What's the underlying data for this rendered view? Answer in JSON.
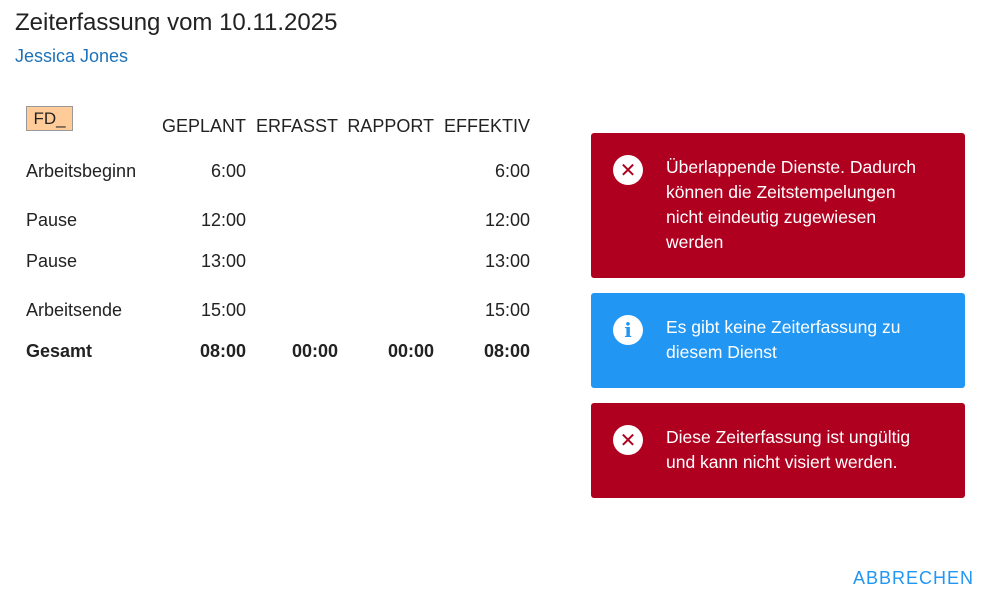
{
  "header": {
    "title": "Zeiterfassung vom 10.11.2025",
    "person": "Jessica Jones"
  },
  "shift": {
    "badge": "FD_",
    "badge_color": "#ffcc99"
  },
  "table": {
    "columns": [
      "GEPLANT",
      "ERFASST",
      "RAPPORT",
      "EFFEKTIV"
    ],
    "rows": [
      {
        "label": "Arbeitsbeginn",
        "geplant": "6:00",
        "erfasst": "",
        "rapport": "",
        "effektiv": "6:00"
      },
      {
        "label": "Pause",
        "geplant": "12:00",
        "erfasst": "",
        "rapport": "",
        "effektiv": "12:00"
      },
      {
        "label": "Pause",
        "geplant": "13:00",
        "erfasst": "",
        "rapport": "",
        "effektiv": "13:00"
      },
      {
        "label": "Arbeitsende",
        "geplant": "15:00",
        "erfasst": "",
        "rapport": "",
        "effektiv": "15:00"
      }
    ],
    "total": {
      "label": "Gesamt",
      "geplant": "08:00",
      "erfasst": "00:00",
      "rapport": "00:00",
      "effektiv": "08:00"
    }
  },
  "alerts": [
    {
      "type": "error",
      "icon": "close-circle-icon",
      "color": "#b00020",
      "lines": [
        "Überlappende Dienste. Dadurch",
        "können die Zeitstempelungen",
        "nicht eindeutig zugewiesen",
        "werden"
      ]
    },
    {
      "type": "info",
      "icon": "info-circle-icon",
      "color": "#2196f3",
      "lines": [
        "Es gibt keine Zeiterfassung zu",
        "diesem Dienst"
      ]
    },
    {
      "type": "error",
      "icon": "close-circle-icon",
      "color": "#b00020",
      "lines": [
        "Diese Zeiterfassung ist ungültig",
        "und kann nicht visiert werden."
      ]
    }
  ],
  "actions": {
    "cancel_label": "ABBRECHEN"
  }
}
